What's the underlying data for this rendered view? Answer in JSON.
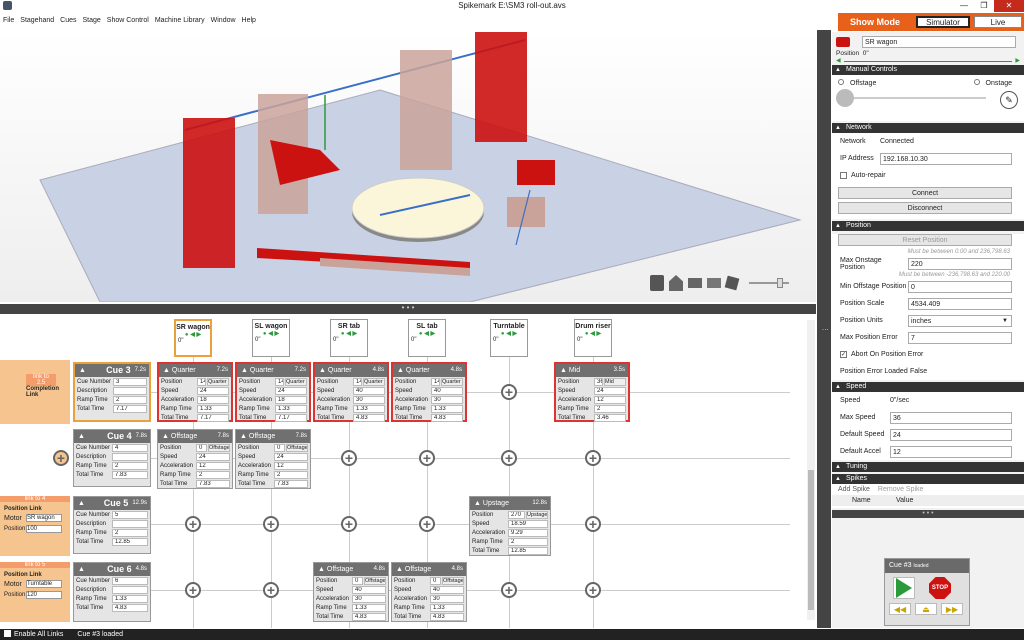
{
  "window": {
    "title": "Spikemark E:\\SM3 roll-out.avs",
    "min": "—",
    "max": "❐",
    "close": "✕"
  },
  "menu": [
    "File",
    "Stagehand",
    "Cues",
    "Stage",
    "Show Control",
    "Machine Library",
    "Window",
    "Help"
  ],
  "mode": {
    "label": "Show Mode",
    "simulator": "Simulator",
    "live": "Live"
  },
  "machines": [
    {
      "name": "SR wagon",
      "pos": "0\"",
      "num": "#1"
    },
    {
      "name": "SL wagon",
      "pos": "0\"",
      "num": "#3"
    },
    {
      "name": "SR tab",
      "pos": "0\"",
      "num": "#3"
    },
    {
      "name": "SL tab",
      "pos": "0\"",
      "num": "#3"
    },
    {
      "name": "Turntable",
      "pos": "0\"",
      "num": "#3"
    },
    {
      "name": "Drum riser",
      "pos": "0\"",
      "num": "#3"
    }
  ],
  "cues": [
    {
      "num": "3",
      "time": "7.2s",
      "cue_number": "3",
      "description": "",
      "ramp_time": "2",
      "total_time": "7.17"
    },
    {
      "num": "4",
      "time": "7.8s",
      "cue_number": "4",
      "description": "",
      "ramp_time": "2",
      "total_time": "7.83"
    },
    {
      "num": "5",
      "time": "12.9s",
      "cue_number": "5",
      "description": "",
      "ramp_time": "2",
      "total_time": "12.85"
    },
    {
      "num": "6",
      "time": "4.8s",
      "cue_number": "6",
      "description": "",
      "ramp_time": "1.33",
      "total_time": "4.83"
    }
  ],
  "cue_labels": {
    "prefix": "Cue",
    "cue_number": "Cue Number",
    "description": "Description",
    "ramp_time": "Ramp Time",
    "total_time": "Total Time"
  },
  "field_labels": {
    "position": "Position",
    "speed": "Speed",
    "acceleration": "Acceleration",
    "ramp_time": "Ramp Time",
    "total_time": "Total Time"
  },
  "actions": {
    "r3_sr": {
      "name": "Quarter",
      "t": "7.2s",
      "position": "140",
      "btn": "Quarter",
      "speed": "24",
      "accel": "18",
      "ramp": "1.33",
      "total": "7.17"
    },
    "r3_sl": {
      "name": "Quarter",
      "t": "7.2s",
      "position": "140",
      "btn": "Quarter",
      "speed": "24",
      "accel": "18",
      "ramp": "1.33",
      "total": "7.17"
    },
    "r3_srt": {
      "name": "Quarter",
      "t": "4.8s",
      "position": "140",
      "btn": "Quarter",
      "speed": "40",
      "accel": "30",
      "ramp": "1.33",
      "total": "4.83"
    },
    "r3_slt": {
      "name": "Quarter",
      "t": "4.8s",
      "position": "140",
      "btn": "Quarter",
      "speed": "40",
      "accel": "30",
      "ramp": "1.33",
      "total": "4.83"
    },
    "r3_drum": {
      "name": "Mid",
      "t": "3.5s",
      "position": "36",
      "btn": "Mid",
      "speed": "24",
      "accel": "12",
      "ramp": "2",
      "total": "3.46"
    },
    "r4_sr": {
      "name": "Offstage",
      "t": "7.8s",
      "position": "0",
      "btn": "Offstage",
      "speed": "24",
      "accel": "12",
      "ramp": "2",
      "total": "7.83"
    },
    "r4_sl": {
      "name": "Offstage",
      "t": "7.8s",
      "position": "0",
      "btn": "Offstage",
      "speed": "24",
      "accel": "12",
      "ramp": "2",
      "total": "7.83"
    },
    "r5_tt": {
      "name": "Upstage",
      "t": "12.8s",
      "position": "270",
      "btn": "Upstage",
      "speed": "18.59",
      "accel": "9.29",
      "ramp": "2",
      "total": "12.85"
    },
    "r6_srt": {
      "name": "Offstage",
      "t": "4.8s",
      "position": "0",
      "btn": "Offstage",
      "speed": "40",
      "accel": "30",
      "ramp": "1.33",
      "total": "4.83"
    },
    "r6_slt": {
      "name": "Offstage",
      "t": "4.8s",
      "position": "0",
      "btn": "Offstage",
      "speed": "40",
      "accel": "30",
      "ramp": "1.33",
      "total": "4.83"
    }
  },
  "links": {
    "link1": {
      "tag": "link to",
      "num": "2.5",
      "name": "Completion Link"
    },
    "link2": {
      "tag": "link to",
      "num": "4",
      "name": "Position Link",
      "motor_label": "Motor",
      "motor": "SR wagon",
      "position_label": "Position",
      "position": "100"
    },
    "link3": {
      "tag": "link to",
      "num": "5",
      "name": "Position Link",
      "motor_label": "Motor",
      "motor": "Turntable",
      "position_label": "Position",
      "position": "120"
    }
  },
  "right": {
    "machine_name": "SR wagon",
    "position_label": "Position",
    "position_value": "0\"",
    "manual": {
      "title": "Manual Controls",
      "offstage": "Offstage",
      "onstage": "Onstage"
    },
    "network": {
      "title": "Network",
      "network_label": "Network",
      "network_value": "Connected",
      "ip_label": "IP Address",
      "ip": "192.168.10.30",
      "auto_repair": "Auto-repair",
      "connect": "Connect",
      "disconnect": "Disconnect"
    },
    "position": {
      "title": "Position",
      "reset": "Reset Position",
      "note1": "Must be between 0.00 and 236,798.63",
      "max_on_label": "Max Onstage Position",
      "max_on": "220",
      "note2": "Must be between -236,798.63 and 220.00",
      "min_off_label": "Min Offstage Position",
      "min_off": "0",
      "scale_label": "Position Scale",
      "scale": "4534.409",
      "units_label": "Position Units",
      "units": "inches",
      "max_err_label": "Max Position Error",
      "max_err": "7",
      "abort_label": "Abort On Position Error",
      "err_loaded_label": "Position Error Loaded",
      "err_loaded": "False"
    },
    "speed": {
      "title": "Speed",
      "speed_label": "Speed",
      "speed": "0\"/sec",
      "max_label": "Max Speed",
      "max": "36",
      "default_label": "Default Speed",
      "default": "24",
      "accel_label": "Default Accel",
      "accel": "12"
    },
    "tuning": {
      "title": "Tuning"
    },
    "spikes": {
      "title": "Spikes",
      "add": "Add Spike",
      "remove": "Remove Spike",
      "col_name": "Name",
      "col_value": "Value"
    }
  },
  "playback": {
    "cue": "Cue #3",
    "state": "loaded",
    "stop": "STOP"
  },
  "status": {
    "enable": "Enable All Links",
    "cue": "Cue #3",
    "state": "loaded"
  },
  "colors": {
    "accent": "#e8611a",
    "red": "#cc1111",
    "green": "#2a9a3a"
  }
}
